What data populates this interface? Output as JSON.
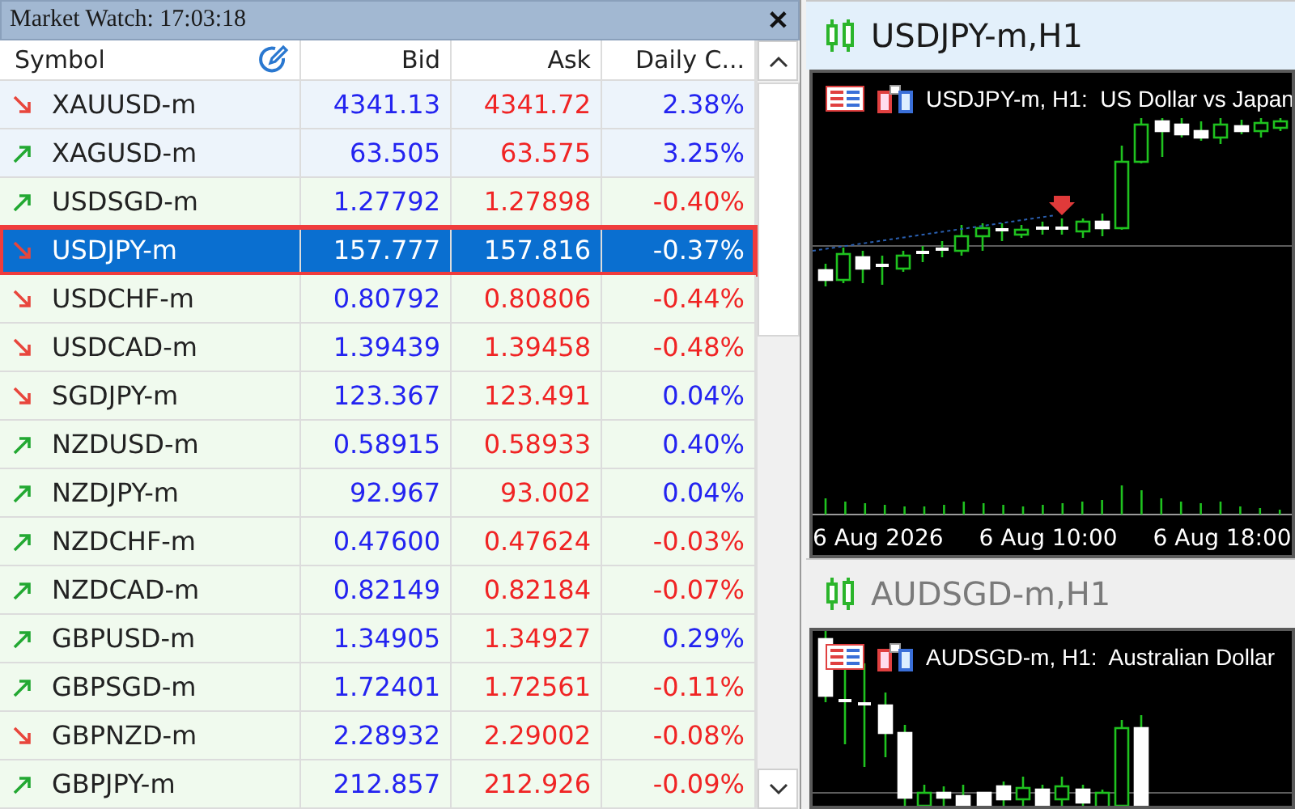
{
  "market_watch": {
    "title": "Market Watch: 17:03:18",
    "close": "✕",
    "columns": [
      "Symbol",
      "Bid",
      "Ask",
      "Daily C..."
    ],
    "rows": [
      {
        "symbol": "XAUUSD-m",
        "bid": "4341.13",
        "ask": "4341.72",
        "change": "2.38%",
        "rising": false,
        "change_negative": false,
        "selected": false,
        "color": "#edf4fb"
      },
      {
        "symbol": "XAGUSD-m",
        "bid": "63.505",
        "ask": "63.575",
        "change": "3.25%",
        "rising": true,
        "change_negative": false,
        "selected": false,
        "color": "#edf4fb"
      },
      {
        "symbol": "USDSGD-m",
        "bid": "1.27792",
        "ask": "1.27898",
        "change": "-0.40%",
        "rising": true,
        "change_negative": true,
        "selected": false,
        "color": "#f0faee"
      },
      {
        "symbol": "USDJPY-m",
        "bid": "157.777",
        "ask": "157.816",
        "change": "-0.37%",
        "rising": false,
        "change_negative": true,
        "selected": true,
        "color": "#0a6fd0"
      },
      {
        "symbol": "USDCHF-m",
        "bid": "0.80792",
        "ask": "0.80806",
        "change": "-0.44%",
        "rising": false,
        "change_negative": true,
        "selected": false,
        "color": "#f0faee"
      },
      {
        "symbol": "USDCAD-m",
        "bid": "1.39439",
        "ask": "1.39458",
        "change": "-0.48%",
        "rising": false,
        "change_negative": true,
        "selected": false,
        "color": "#f0faee"
      },
      {
        "symbol": "SGDJPY-m",
        "bid": "123.367",
        "ask": "123.491",
        "change": "0.04%",
        "rising": false,
        "change_negative": false,
        "selected": false,
        "color": "#f0faee"
      },
      {
        "symbol": "NZDUSD-m",
        "bid": "0.58915",
        "ask": "0.58933",
        "change": "0.40%",
        "rising": true,
        "change_negative": false,
        "selected": false,
        "color": "#f0faee"
      },
      {
        "symbol": "NZDJPY-m",
        "bid": "92.967",
        "ask": "93.002",
        "change": "0.04%",
        "rising": true,
        "change_negative": false,
        "selected": false,
        "color": "#f0faee"
      },
      {
        "symbol": "NZDCHF-m",
        "bid": "0.47600",
        "ask": "0.47624",
        "change": "-0.03%",
        "rising": true,
        "change_negative": true,
        "selected": false,
        "color": "#f0faee"
      },
      {
        "symbol": "NZDCAD-m",
        "bid": "0.82149",
        "ask": "0.82184",
        "change": "-0.07%",
        "rising": true,
        "change_negative": true,
        "selected": false,
        "color": "#f0faee"
      },
      {
        "symbol": "GBPUSD-m",
        "bid": "1.34905",
        "ask": "1.34927",
        "change": "0.29%",
        "rising": true,
        "change_negative": false,
        "selected": false,
        "color": "#f0faee"
      },
      {
        "symbol": "GBPSGD-m",
        "bid": "1.72401",
        "ask": "1.72561",
        "change": "-0.11%",
        "rising": true,
        "change_negative": true,
        "selected": false,
        "color": "#f0faee"
      },
      {
        "symbol": "GBPNZD-m",
        "bid": "2.28932",
        "ask": "2.29002",
        "change": "-0.08%",
        "rising": false,
        "change_negative": true,
        "selected": false,
        "color": "#f0faee"
      },
      {
        "symbol": "GBPJPY-m",
        "bid": "212.857",
        "ask": "212.926",
        "change": "-0.09%",
        "rising": true,
        "change_negative": true,
        "selected": false,
        "color": "#f0faee"
      }
    ]
  },
  "charts": [
    {
      "tab": "USDJPY-m,H1",
      "active": true,
      "title": "USDJPY-m, H1:  US Dollar vs Japan",
      "time_labels": [
        "6 Aug 2026",
        "6 Aug 10:00",
        "6 Aug 18:00"
      ]
    },
    {
      "tab": "AUDSGD-m,H1",
      "active": false,
      "title": "AUDSGD-m, H1:  Australian Dollar"
    }
  ]
}
